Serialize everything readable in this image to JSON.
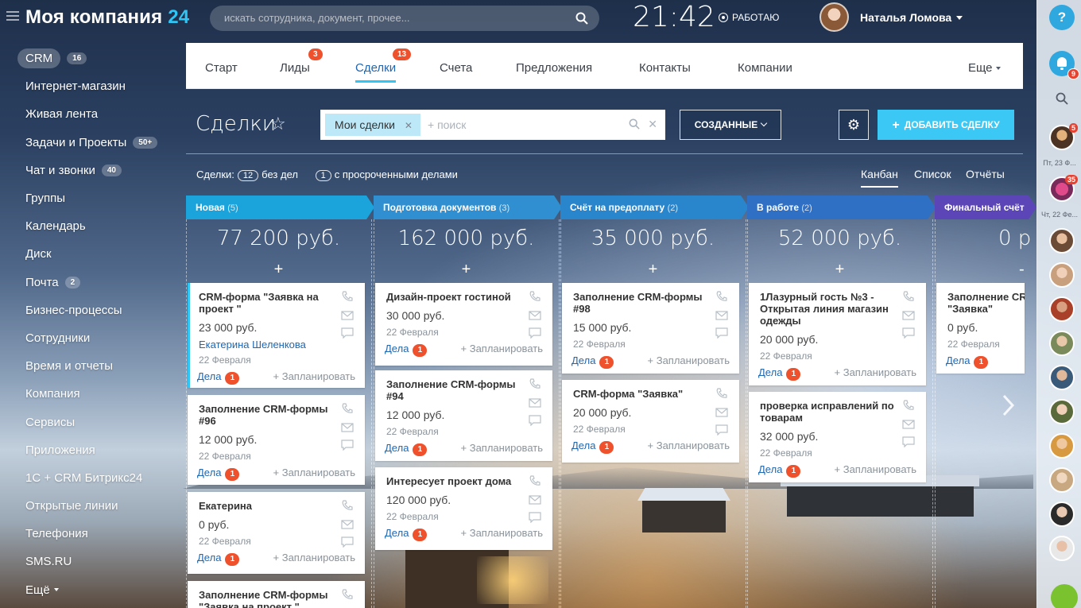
{
  "header": {
    "logo_main": "Моя компания",
    "logo_num": "24",
    "search_placeholder": "искать сотрудника, документ, прочее...",
    "time": "21:42",
    "status": "РАБОТАЮ",
    "user_name": "Наталья Ломова"
  },
  "left_menu": [
    {
      "label": "CRM",
      "count": "16",
      "active": true
    },
    {
      "label": "Интернет-магазин"
    },
    {
      "label": "Живая лента"
    },
    {
      "label": "Задачи и Проекты",
      "count": "50+"
    },
    {
      "label": "Чат и звонки",
      "count": "40"
    },
    {
      "label": "Группы"
    },
    {
      "label": "Календарь"
    },
    {
      "label": "Диск"
    },
    {
      "label": "Почта",
      "count": "2"
    },
    {
      "label": "Бизнес-процессы"
    },
    {
      "label": "Сотрудники"
    },
    {
      "label": "Время и отчеты"
    },
    {
      "label": "Компания"
    },
    {
      "label": "Сервисы"
    },
    {
      "label": "Приложения"
    },
    {
      "label": "1С + CRM Битрикс24"
    },
    {
      "label": "Открытые линии"
    },
    {
      "label": "Телефония"
    },
    {
      "label": "SMS.RU"
    },
    {
      "label": "Ещё"
    }
  ],
  "tabs": [
    {
      "label": "Старт"
    },
    {
      "label": "Лиды",
      "badge": "3"
    },
    {
      "label": "Сделки",
      "badge": "13",
      "active": true
    },
    {
      "label": "Счета"
    },
    {
      "label": "Предложения"
    },
    {
      "label": "Контакты"
    },
    {
      "label": "Компании"
    },
    {
      "label": "Еще"
    }
  ],
  "toolbar": {
    "title": "Сделки",
    "filter_chip": "Мои сделки",
    "filter_placeholder": "+ поиск",
    "created_button": "СОЗДАННЫЕ",
    "add_button": "ДОБАВИТЬ СДЕЛКУ"
  },
  "summary": {
    "deals_label": "Сделки:",
    "no_tasks_count": "12",
    "no_tasks_label": "без дел",
    "overdue_count": "1",
    "overdue_label": "с просроченными делами"
  },
  "views": [
    "Канбан",
    "Список",
    "Отчёты"
  ],
  "right_panel": {
    "bell_badge": "9",
    "avatar1_badge": "5",
    "date1": "Пт, 23 Ф...",
    "avatar2_badge": "35",
    "date2": "Чт, 22 Фе..."
  },
  "common": {
    "deals_label": "Дела",
    "plan_label": "+ Запланировать"
  },
  "colors": {
    "stage_new": "#1ba3dc",
    "stage_docs": "#2f8fd0",
    "stage_invoice": "#2a86cc",
    "stage_work": "#2f6fc4",
    "stage_final": "#5b45b7",
    "accent": "#2fc6f6",
    "badge": "#f0512d"
  },
  "columns": [
    {
      "name": "Новая",
      "count": "(5)",
      "sum": "77 200 руб.",
      "cards": [
        {
          "title": "CRM-форма \"Заявка на проект \"",
          "price": "23 000 руб.",
          "person": "Екатерина Шеленкова",
          "date": "22 Февраля",
          "deals": "1"
        },
        {
          "title": "Заполнение CRM-формы #96",
          "price": "12 000 руб.",
          "date": "22 Февраля",
          "deals": "1"
        },
        {
          "title": "Екатерина",
          "price": "0 руб.",
          "date": "22 Февраля",
          "deals": "1"
        },
        {
          "title": "Заполнение CRM-формы \"Заявка на проект \""
        }
      ]
    },
    {
      "name": "Подготовка документов",
      "count": "(3)",
      "sum": "162 000 руб.",
      "cards": [
        {
          "title": "Дизайн-проект гостиной",
          "price": "30 000 руб.",
          "date": "22 Февраля",
          "deals": "1"
        },
        {
          "title": "Заполнение CRM-формы #94",
          "price": "12 000 руб.",
          "date": "22 Февраля",
          "deals": "1"
        },
        {
          "title": "Интересует проект дома",
          "price": "120 000 руб.",
          "date": "22 Февраля",
          "deals": "1"
        }
      ]
    },
    {
      "name": "Счёт на предоплату",
      "count": "(2)",
      "sum": "35 000 руб.",
      "cards": [
        {
          "title": "Заполнение CRM-формы #98",
          "price": "15 000 руб.",
          "date": "22 Февраля",
          "deals": "1"
        },
        {
          "title": "CRM-форма \"Заявка\"",
          "price": "20 000 руб.",
          "date": "22 Февраля",
          "deals": "1"
        }
      ]
    },
    {
      "name": "В работе",
      "count": "(2)",
      "sum": "52 000 руб.",
      "cards": [
        {
          "title": "1Лазурный гость №3 - Открытая линия магазин одежды",
          "price": "20 000 руб.",
          "date": "22 Февраля",
          "deals": "1"
        },
        {
          "title": "проверка исправлений по товарам",
          "price": "32 000 руб.",
          "date": "22 Февраля",
          "deals": "1"
        }
      ]
    },
    {
      "name": "Финальный счёт",
      "sum": "0 р",
      "cards": [
        {
          "title": "Заполнение CR \"Заявка\"",
          "price": "0 руб.",
          "date": "22 Февраля",
          "deals": "1"
        }
      ]
    }
  ]
}
